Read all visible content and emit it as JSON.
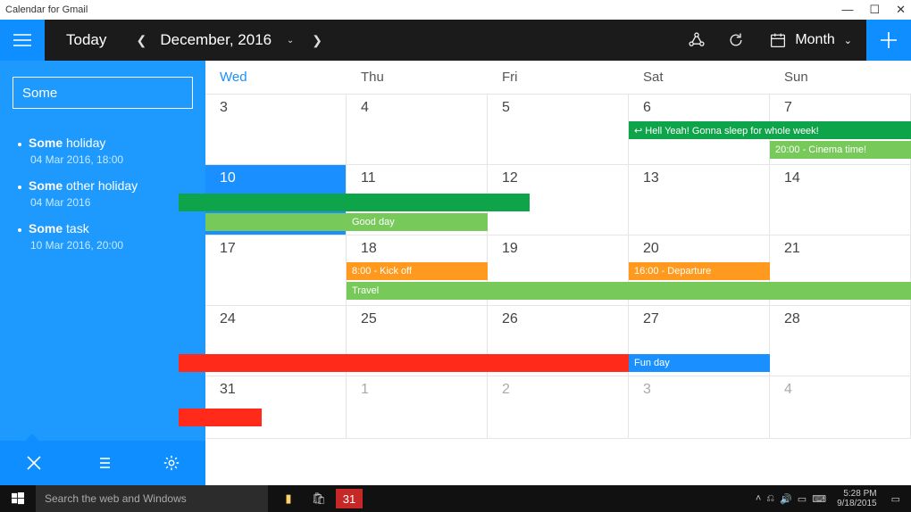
{
  "window": {
    "title": "Calendar for Gmail"
  },
  "toolbar": {
    "today_label": "Today",
    "month_label": "December, 2016",
    "view_label": "Month"
  },
  "sidebar": {
    "search_value": "Some",
    "items": [
      {
        "title_bold": "Some",
        "title_rest": " holiday",
        "sub": "04 Mar 2016, 18:00"
      },
      {
        "title_bold": "Some",
        "title_rest": " other holiday",
        "sub": "04 Mar 2016"
      },
      {
        "title_bold": "Some",
        "title_rest": " task",
        "sub": "10 Mar 2016, 20:00"
      }
    ]
  },
  "calendar": {
    "day_headers": [
      "Wed",
      "Thu",
      "Fri",
      "Sat",
      "Sun"
    ],
    "rows": [
      {
        "cells": [
          "3",
          "4",
          "5",
          "6",
          "7"
        ]
      },
      {
        "cells": [
          "10",
          "11",
          "12",
          "13",
          "14"
        ],
        "today_index": 0,
        "chevron_index": 1
      },
      {
        "cells": [
          "17",
          "18",
          "19",
          "20",
          "21"
        ]
      },
      {
        "cells": [
          "24",
          "25",
          "26",
          "27",
          "28"
        ]
      },
      {
        "cells": [
          "31",
          "1",
          "2",
          "3",
          "4"
        ],
        "other_from": 1
      }
    ],
    "events": {
      "hellyeah": "↩  Hell Yeah! Gonna sleep for whole week!",
      "cinema": "20:00 - Cinema time!",
      "goodday": "Good day",
      "kickoff": "8:00 - Kick off",
      "departure": "16:00 - Departure",
      "travel": "Travel",
      "funday": "Fun day"
    }
  },
  "taskbar": {
    "search_placeholder": "Search the web and Windows",
    "time": "5:28 PM",
    "date": "9/18/2015"
  }
}
